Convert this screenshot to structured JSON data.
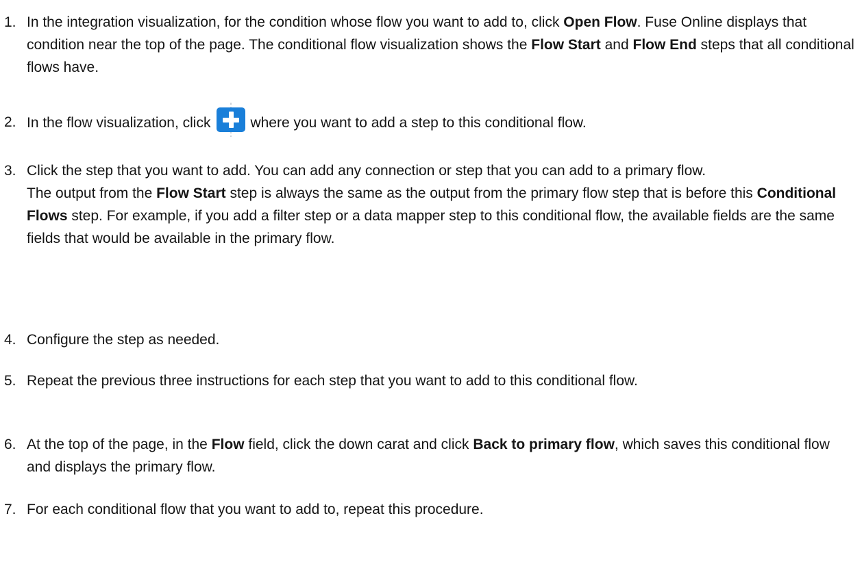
{
  "steps": [
    {
      "number": "1.",
      "parts": [
        {
          "text": "In the integration visualization, for the condition whose flow you want to add to, click "
        },
        {
          "text": "Open Flow",
          "bold": true
        },
        {
          "text": ". Fuse Online displays that condition near the top of the page. The conditional flow visualization shows the "
        },
        {
          "text": "Flow Start",
          "bold": true
        },
        {
          "text": " and "
        },
        {
          "text": "Flow End",
          "bold": true
        },
        {
          "text": " steps that all conditional flows have."
        }
      ]
    },
    {
      "number": "2.",
      "icon": "add-step-plus-icon",
      "before_icon": "In the flow visualization, click",
      "after_icon": "where you want to add a step to this conditional flow."
    },
    {
      "number": "3.",
      "parts": [
        {
          "text": "Click the step that you want to add. You can add any connection or step that you can add to a primary flow."
        }
      ],
      "note_parts": [
        {
          "text": "The output from the "
        },
        {
          "text": "Flow Start",
          "bold": true
        },
        {
          "text": " step is always the same as the output from the primary flow step that is before this "
        },
        {
          "text": "Conditional Flows",
          "bold": true
        },
        {
          "text": " step. For example, if you add a filter step or a data mapper step to this conditional flow, the available fields are the same fields that would be available in the primary flow."
        }
      ]
    },
    {
      "number": "4.",
      "parts": [
        {
          "text": "Configure the step as needed."
        }
      ]
    },
    {
      "number": "5.",
      "parts": [
        {
          "text": "Repeat the previous three instructions for each step that you want to add to this conditional flow."
        }
      ]
    },
    {
      "number": "6.",
      "parts": [
        {
          "text": "At the top of the page, in the "
        },
        {
          "text": "Flow",
          "bold": true
        },
        {
          "text": " field, click the down carat and click "
        },
        {
          "text": "Back to primary flow",
          "bold": true
        },
        {
          "text": ", which saves this conditional flow and displays the primary flow."
        }
      ]
    },
    {
      "number": "7.",
      "parts": [
        {
          "text": "For each conditional flow that you want to add to, repeat this procedure."
        }
      ]
    }
  ]
}
